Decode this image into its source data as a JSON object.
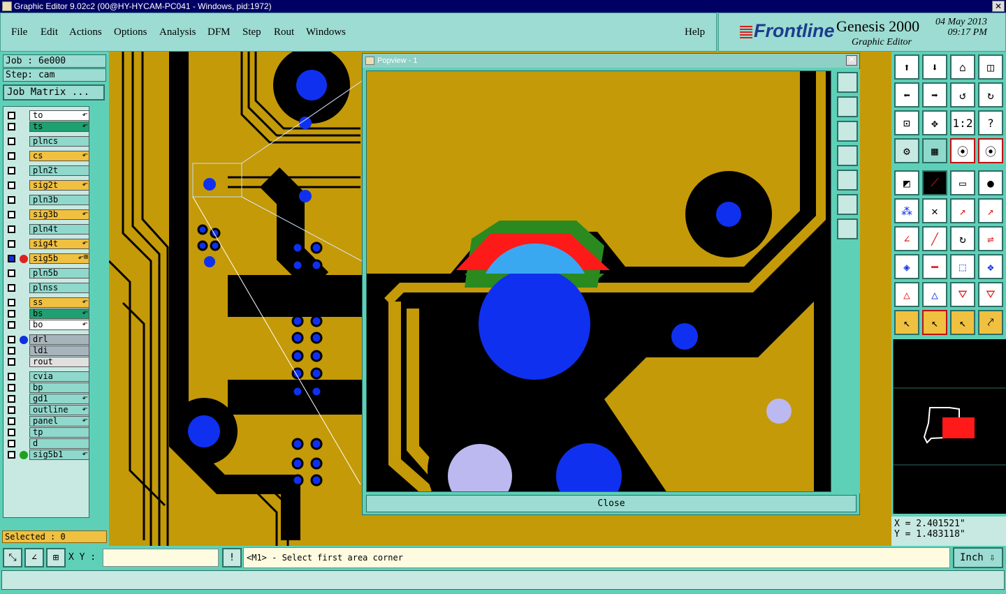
{
  "window": {
    "title": "Graphic Editor 9.02c2 (00@HY-HYCAM-PC041 - Windows, pid:1972)",
    "close_icon": "close-x-icon"
  },
  "menu": {
    "file": "File",
    "edit": "Edit",
    "actions": "Actions",
    "options": "Options",
    "analysis": "Analysis",
    "dfm": "DFM",
    "step": "Step",
    "rout": "Rout",
    "windows": "Windows",
    "help": "Help"
  },
  "brand": {
    "logo": "Frontline",
    "product": "Genesis 2000",
    "subtitle": "Graphic Editor",
    "date": "04 May 2013",
    "time": "09:17 PM"
  },
  "left": {
    "job": "Job : 6e000",
    "step": "Step: cam",
    "job_matrix": "Job Matrix ...",
    "selected": "Selected : 0"
  },
  "layers": [
    {
      "name": "to",
      "color": "#ffffff",
      "flag": "⬐",
      "dot": ""
    },
    {
      "name": "ts",
      "color": "#1ea070",
      "flag": "⬐",
      "dot": ""
    },
    {
      "name": "plncs",
      "color": "#8fd8cc",
      "flag": "",
      "dot": ""
    },
    {
      "name": "cs",
      "color": "#f0c040",
      "flag": "⬐",
      "dot": ""
    },
    {
      "name": "pln2t",
      "color": "#8fd8cc",
      "flag": "",
      "dot": ""
    },
    {
      "name": "sig2t",
      "color": "#f0c040",
      "flag": "⬐",
      "dot": ""
    },
    {
      "name": "pln3b",
      "color": "#8fd8cc",
      "flag": "",
      "dot": ""
    },
    {
      "name": "sig3b",
      "color": "#f0c040",
      "flag": "⬐",
      "dot": ""
    },
    {
      "name": "pln4t",
      "color": "#8fd8cc",
      "flag": "",
      "dot": ""
    },
    {
      "name": "sig4t",
      "color": "#f0c040",
      "flag": "⬐",
      "dot": ""
    },
    {
      "name": "sig5b",
      "color": "#f0c040",
      "flag": "⬐⊞",
      "dot": "#e02020"
    },
    {
      "name": "pln5b",
      "color": "#8fd8cc",
      "flag": "",
      "dot": ""
    },
    {
      "name": "plnss",
      "color": "#8fd8cc",
      "flag": "",
      "dot": ""
    },
    {
      "name": "ss",
      "color": "#f0c040",
      "flag": "⬐",
      "dot": ""
    },
    {
      "name": "bs",
      "color": "#1ea070",
      "flag": "⬐",
      "dot": ""
    },
    {
      "name": "bo",
      "color": "#ffffff",
      "flag": "⬐",
      "dot": ""
    },
    {
      "name": "drl",
      "color": "#a8b4bc",
      "flag": "",
      "dot": "#1030e0"
    },
    {
      "name": "ldi",
      "color": "#a8b4bc",
      "flag": "",
      "dot": ""
    },
    {
      "name": "rout",
      "color": "#e0e0e0",
      "flag": "",
      "dot": ""
    },
    {
      "name": "cvia",
      "color": "#8fd8cc",
      "flag": "",
      "dot": ""
    },
    {
      "name": "bp",
      "color": "#8fd8cc",
      "flag": "",
      "dot": ""
    },
    {
      "name": "gd1",
      "color": "#8fd8cc",
      "flag": "⬐",
      "dot": ""
    },
    {
      "name": "outline",
      "color": "#8fd8cc",
      "flag": "⬐",
      "dot": ""
    },
    {
      "name": "panel",
      "color": "#8fd8cc",
      "flag": "⬐",
      "dot": ""
    },
    {
      "name": "tp",
      "color": "#8fd8cc",
      "flag": "",
      "dot": ""
    },
    {
      "name": "d",
      "color": "#8fd8cc",
      "flag": "",
      "dot": ""
    },
    {
      "name": "sig5b1",
      "color": "#8fd8cc",
      "flag": "⬐",
      "dot": "#20a020"
    }
  ],
  "popview": {
    "title": "Popview - 1",
    "close": "Close"
  },
  "coords": {
    "x": "X = 2.401521\"",
    "y": "Y = 1.483118\""
  },
  "status": {
    "xy_label": "X Y :",
    "prompt": "<M1> - Select first area corner",
    "units": "Inch ⇩",
    "warn": "!",
    "ratio": "1:2",
    "help_q": "?"
  }
}
